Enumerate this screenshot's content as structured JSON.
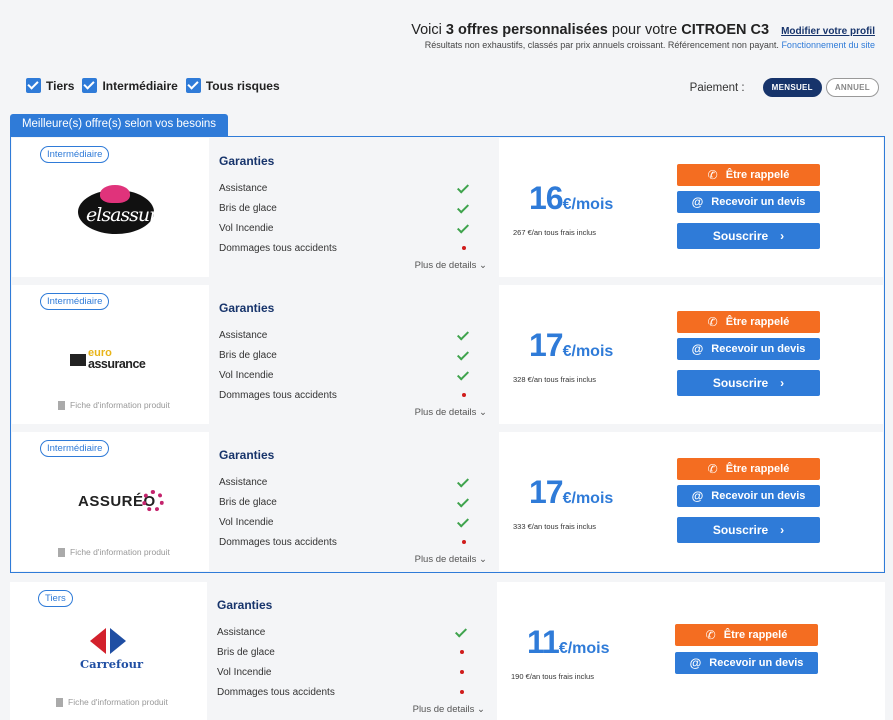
{
  "header": {
    "line1_pre": "Voici ",
    "line1_bold": "3 offres personnalisées",
    "line1_mid": " pour votre ",
    "line1_car": "CITROEN C3",
    "modify_link": "Modifier votre profil",
    "subtext": "Résultats non exhaustifs, classés par prix annuels croissant. Référencement non payant.",
    "subtext_link": "Fonctionnement du site"
  },
  "filters": [
    {
      "label": "Tiers",
      "checked": true
    },
    {
      "label": "Intermédiaire",
      "checked": true
    },
    {
      "label": "Tous risques",
      "checked": true
    }
  ],
  "payment": {
    "label": "Paiement :",
    "options": [
      "MENSUEL",
      "ANNUEL"
    ],
    "selected": "MENSUEL"
  },
  "best_tab": "Meilleure(s) offre(s) selon vos besoins",
  "common": {
    "guarantees_title": "Garanties",
    "more_details": "Plus de details ⌄",
    "fiche": "Fiche d'information produit",
    "btn_callback": "Être rappelé",
    "btn_quote": "Recevoir un devis",
    "btn_subscribe": "Souscrire",
    "unit": "€/mois",
    "guarantee_names": [
      "Assistance",
      "Bris de glace",
      "Vol Incendie",
      "Dommages tous accidents"
    ]
  },
  "offers": [
    {
      "level": "Intermédiaire",
      "logo_text": "elsassur",
      "price": "16",
      "annual": "267 €/an tous frais inclus",
      "has_fiche": false,
      "has_subscribe": true,
      "guarantees": [
        true,
        true,
        true,
        false
      ]
    },
    {
      "level": "Intermédiaire",
      "logo_text": "euro assurance",
      "price": "17",
      "annual": "328 €/an tous frais inclus",
      "has_fiche": true,
      "has_subscribe": true,
      "guarantees": [
        true,
        true,
        true,
        false
      ]
    },
    {
      "level": "Intermédiaire",
      "logo_text": "ASSURÉO",
      "price": "17",
      "annual": "333 €/an tous frais inclus",
      "has_fiche": true,
      "has_subscribe": true,
      "guarantees": [
        true,
        true,
        true,
        false
      ]
    },
    {
      "level": "Tiers",
      "logo_text": "Carrefour",
      "price": "11",
      "annual": "190 €/an tous frais inclus",
      "has_fiche": true,
      "has_subscribe": false,
      "guarantees": [
        true,
        false,
        false,
        false
      ]
    }
  ],
  "colors": {
    "primary": "#2f7bd8",
    "navy": "#17346b",
    "orange": "#f46d21",
    "check": "#3fa34d",
    "cross": "#d01c1c"
  }
}
